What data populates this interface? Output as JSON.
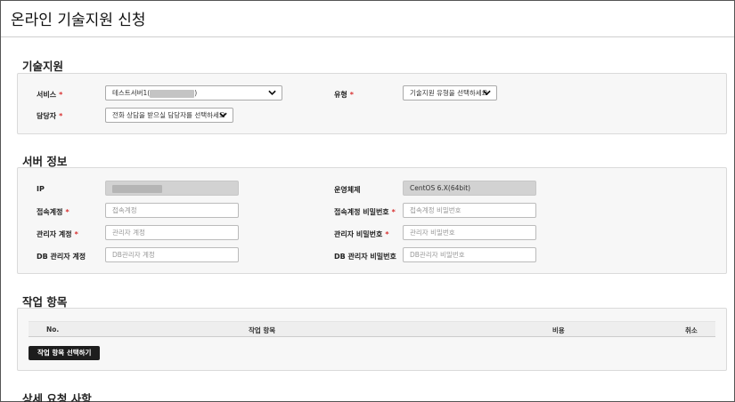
{
  "page": {
    "title": "온라인 기술지원 신청"
  },
  "tech_support": {
    "title": "기술지원",
    "service_label": "서비스",
    "service_value": "테스트서버1(",
    "service_value_suffix": ")",
    "type_label": "유형",
    "type_value": "기술지원 유형을 선택하세요",
    "manager_label": "담당자",
    "manager_value": "전화 상담을 받으실 담당자를 선택하세요"
  },
  "server_info": {
    "title": "서버 정보",
    "ip_label": "IP",
    "os_label": "운영체제",
    "os_value": "CentOS 6.X(64bit)",
    "access_account_label": "접속계정",
    "access_account_placeholder": "접속계정",
    "access_password_label": "접속계정 비밀번호",
    "access_password_placeholder": "접속계정 비밀번호",
    "admin_account_label": "관리자 계정",
    "admin_account_placeholder": "관리자 계정",
    "admin_password_label": "관리자 비밀번호",
    "admin_password_placeholder": "관리자 비밀번호",
    "db_admin_account_label": "DB 관리자 계정",
    "db_admin_account_placeholder": "DB관리자 계정",
    "db_admin_password_label": "DB 관리자 비밀번호",
    "db_admin_password_placeholder": "DB관리자 비밀번호"
  },
  "work_items": {
    "title": "작업 항목",
    "columns": {
      "no": "No.",
      "item": "작업 항목",
      "cost": "비용",
      "cancel": "취소"
    },
    "select_button": "작업 항목 선택하기"
  },
  "details": {
    "title": "상세 요청 사항"
  },
  "required_mark": "*",
  "colors": {
    "required": "#d83030",
    "button_dark": "#1d1d1d",
    "panel_bg": "#f7f7f7"
  }
}
